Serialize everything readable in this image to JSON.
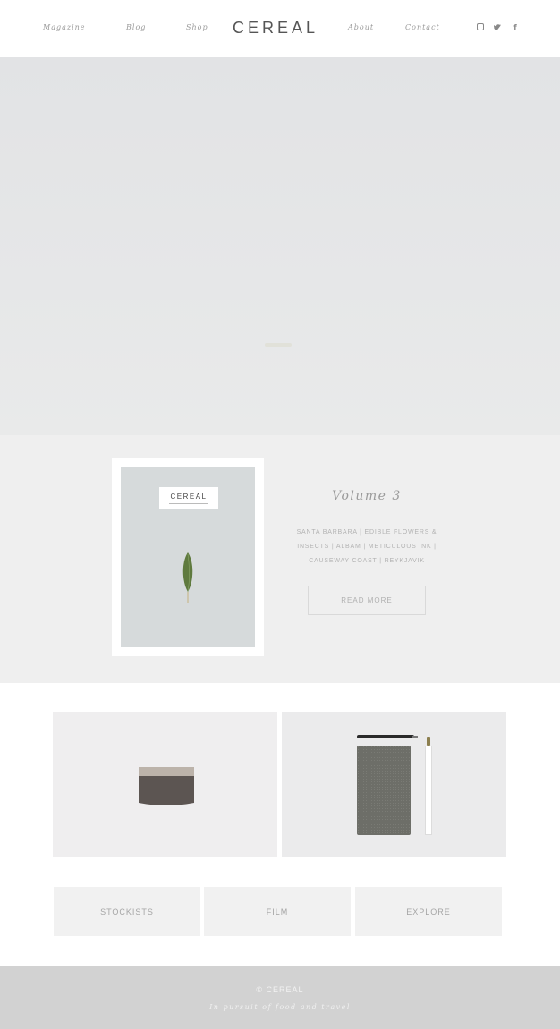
{
  "nav": {
    "items_left": [
      "Magazine",
      "Blog",
      "Shop"
    ],
    "logo": "CEREAL",
    "items_right": [
      "About",
      "Contact"
    ],
    "social_icons": [
      "instagram-icon",
      "twitter-icon",
      "facebook-icon"
    ],
    "twitter_glyph": "♥",
    "facebook_glyph": "f"
  },
  "feature": {
    "cover_title": "CEREAL",
    "volume_title": "Volume 3",
    "description": "SANTA BARBARA | EDIBLE FLOWERS & INSECTS | ALBAM | METICULOUS INK | CAUSEWAY COAST | REYKJAVIK",
    "button_label": "READ MORE"
  },
  "links": [
    "STOCKISTS",
    "FILM",
    "EXPLORE"
  ],
  "footer": {
    "copyright": "© CEREAL",
    "tagline": "In pursuit of food and travel"
  },
  "colors": {
    "hero": "#e4e5e6",
    "feature_bg": "#efefef",
    "footer_bg": "#d2d2d2",
    "cover": "#d6dadb"
  }
}
